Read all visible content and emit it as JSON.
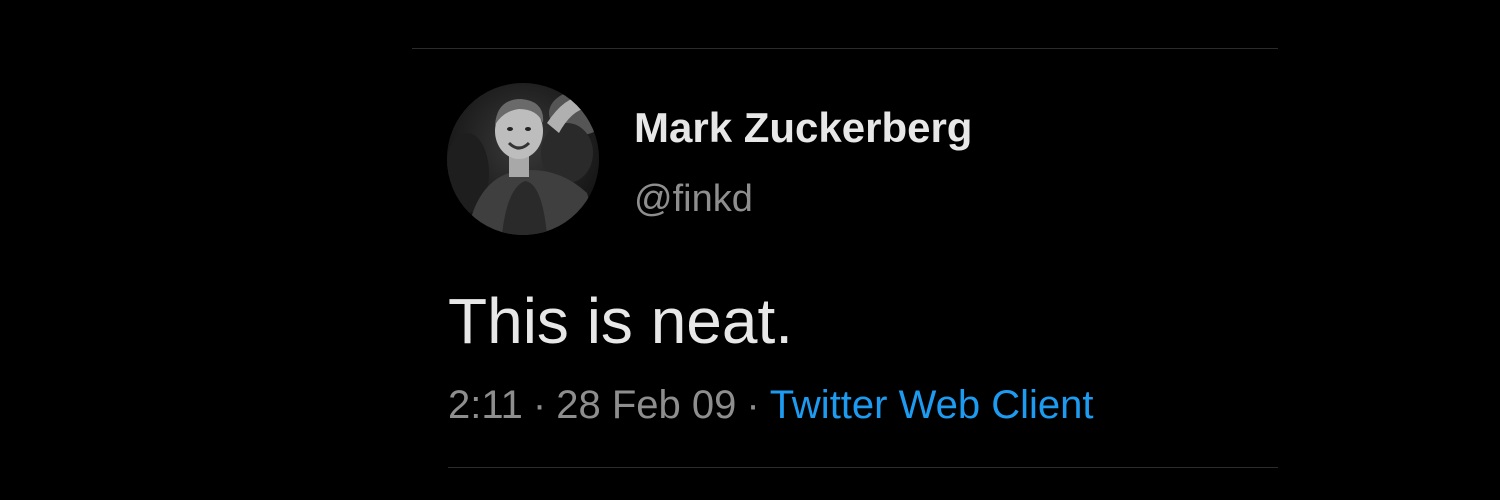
{
  "tweet": {
    "author": {
      "display_name": "Mark Zuckerberg",
      "handle": "@finkd",
      "avatar": "profile-photo"
    },
    "text": "This is neat.",
    "meta": {
      "time": "2:11",
      "separator": "·",
      "date": "28 Feb 09",
      "client": "Twitter Web Client"
    }
  },
  "colors": {
    "background": "#000000",
    "primary_text": "#e7e7e7",
    "secondary_text": "#8e8e8e",
    "link": "#1d9bf0",
    "divider": "#2b2b2b"
  }
}
